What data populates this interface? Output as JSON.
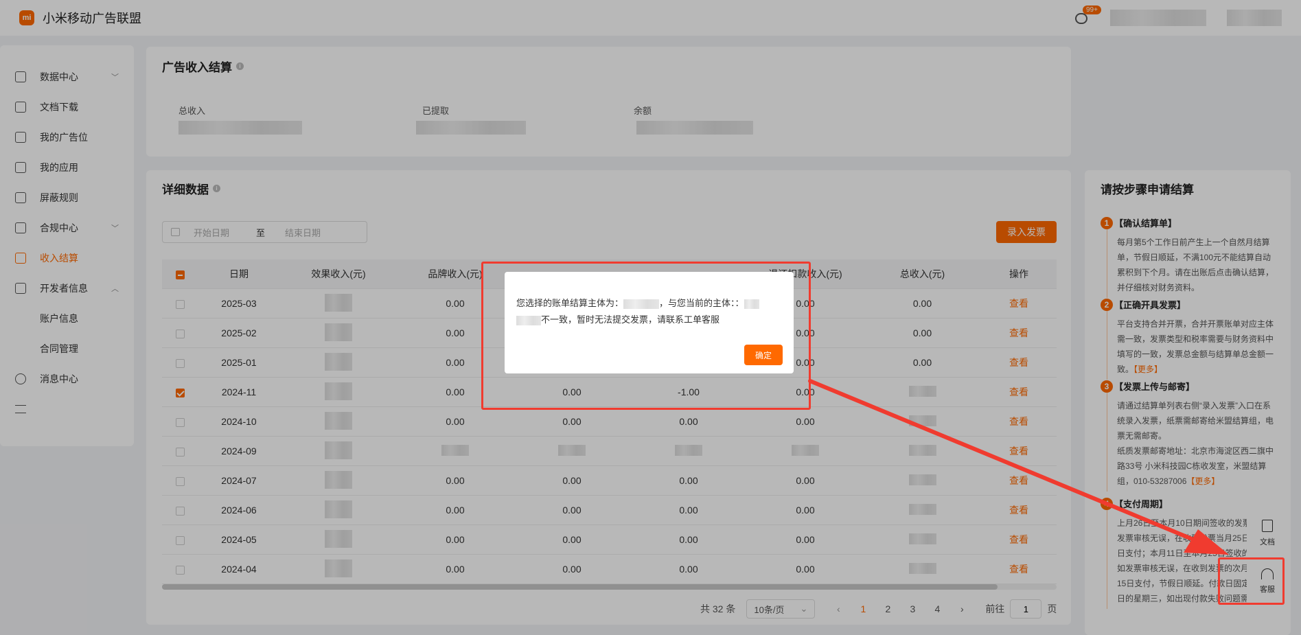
{
  "header": {
    "brand": "小米移动广告联盟",
    "logo_text": "mi",
    "badge": "99+"
  },
  "sidebar": {
    "items": [
      {
        "label": "数据中心",
        "chevron": "﹀"
      },
      {
        "label": "文档下载"
      },
      {
        "label": "我的广告位"
      },
      {
        "label": "我的应用"
      },
      {
        "label": "屏蔽规则"
      },
      {
        "label": "合规中心",
        "chevron": "﹀"
      },
      {
        "label": "收入结算"
      },
      {
        "label": "开发者信息",
        "chevron": "︿"
      },
      {
        "label": "账户信息"
      },
      {
        "label": "合同管理"
      },
      {
        "label": "消息中心"
      }
    ]
  },
  "settlement": {
    "title": "广告收入结算",
    "total_label": "总收入",
    "withdrawn_label": "已提取",
    "balance_label": "余额"
  },
  "detail": {
    "title": "详细数据",
    "start_placeholder": "开始日期",
    "to": "至",
    "end_placeholder": "结束日期",
    "invoice_button": "录入发票",
    "columns": [
      "日期",
      "效果收入(元)",
      "品牌收入(元)",
      "",
      "",
      "退还扣款收入(元)",
      "总收入(元)",
      "操作"
    ],
    "rows": [
      {
        "date": "2025-03",
        "brand": "0.00",
        "c4": "",
        "c5": "",
        "c6": "0.00",
        "total": "0.00",
        "op": "查看"
      },
      {
        "date": "2025-02",
        "brand": "0.00",
        "c4": "",
        "c5": "",
        "c6": "0.00",
        "total": "0.00",
        "op": "查看"
      },
      {
        "date": "2025-01",
        "brand": "0.00",
        "c4": "",
        "c5": "",
        "c6": "0.00",
        "total": "0.00",
        "op": "查看"
      },
      {
        "date": "2024-11",
        "brand": "0.00",
        "c4": "0.00",
        "c5": "-1.00",
        "c6": "0.00",
        "total": "",
        "op": "查看"
      },
      {
        "date": "2024-10",
        "brand": "0.00",
        "c4": "0.00",
        "c5": "0.00",
        "c6": "0.00",
        "total": "",
        "op": "查看"
      },
      {
        "date": "2024-09",
        "brand": "",
        "c4": "",
        "c5": "",
        "c6": "",
        "total": "",
        "op": "查看"
      },
      {
        "date": "2024-07",
        "brand": "0.00",
        "c4": "0.00",
        "c5": "0.00",
        "c6": "0.00",
        "total": "",
        "op": "查看"
      },
      {
        "date": "2024-06",
        "brand": "0.00",
        "c4": "0.00",
        "c5": "0.00",
        "c6": "0.00",
        "total": "",
        "op": "查看"
      },
      {
        "date": "2024-05",
        "brand": "0.00",
        "c4": "0.00",
        "c5": "0.00",
        "c6": "0.00",
        "total": "",
        "op": "查看"
      },
      {
        "date": "2024-04",
        "brand": "0.00",
        "c4": "0.00",
        "c5": "0.00",
        "c6": "0.00",
        "total": "",
        "op": "查看"
      }
    ]
  },
  "pager": {
    "total": "共 32 条",
    "size": "10条/页",
    "pages": [
      "1",
      "2",
      "3",
      "4"
    ],
    "goto_label": "前往",
    "goto_value": "1",
    "page_unit": "页",
    "prev": "‹",
    "next": "›",
    "size_caret": "⌄"
  },
  "steps": {
    "title": "请按步骤申请结算",
    "items": [
      {
        "num": "1",
        "title": "【确认结算单】",
        "body": "每月第5个工作日前产生上一个自然月结算单，节假日顺延，不满100元不能结算自动累积到下个月。请在出账后点击确认结算，并仔细核对财务资料。",
        "more": ""
      },
      {
        "num": "2",
        "title": "【正确开具发票】",
        "body": "平台支持合并开票，合并开票账单对应主体需一致，发票类型和税率需要与财务资料中填写的一致，发票总金额与结算单总金额一致。",
        "more": "【更多】"
      },
      {
        "num": "3",
        "title": "【发票上传与邮寄】",
        "body": "请通过结算单列表右侧“录入发票”入口在系统录入发票，纸票需邮寄给米盟结算组，电票无需邮寄。",
        "body2": "纸质发票邮寄地址：北京市海淀区西二旗中路33号 小米科技园C栋收发室，米盟结算组，010-53287006",
        "more": "【更多】"
      },
      {
        "num": "4",
        "title": "【支付周期】",
        "body": "上月26日至本月10日期间签收的发票，如发票审核无误，在收到发票当月25日至30日支付；本月11日至本月25日签收的发票，如发票审核无误，在收到发票的次月10日至15日支付，节假日顺延。付款日固定为工作日的星期三，如出现付款失败问题需要",
        "more": ""
      }
    ]
  },
  "float_tools": {
    "doc": "文档",
    "service": "客服"
  },
  "modal": {
    "text_a": "您选择的账单结算主体为：",
    "text_b": "，与您当前的主体：：",
    "text_c": "不一致，暂时无法提交发票，请联系工单客服",
    "ok": "确定"
  },
  "annotation_color": "#f03b2f",
  "accent": "#ff6900"
}
